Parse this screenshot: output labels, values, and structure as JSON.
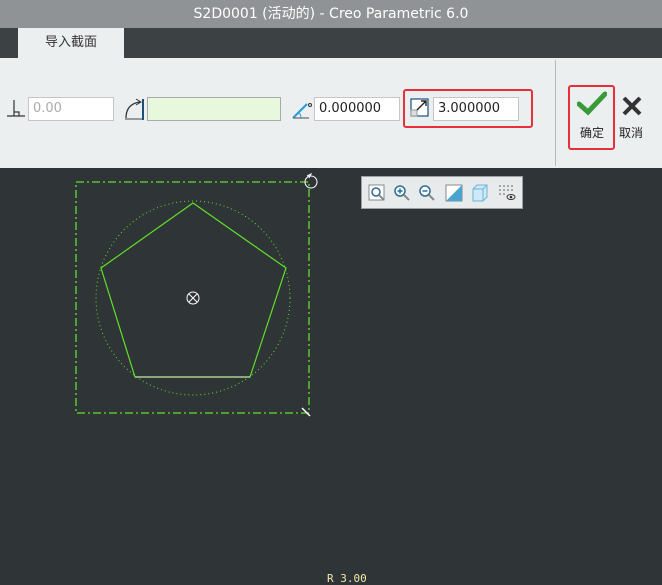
{
  "window": {
    "title": "S2D0001 (活动的) - Creo Parametric 6.0"
  },
  "tabs": [
    {
      "label": "导入截面"
    }
  ],
  "ribbon": {
    "offset_value": "0.00",
    "reference_value": "",
    "rotation_value": "0.000000",
    "scale_value": "3.000000",
    "ok_label": "确定",
    "cancel_label": "取消"
  },
  "canvas": {
    "dimension_label": "R 3.00"
  },
  "colors": {
    "sketch": "#5ee02a",
    "highlight": "#e8303a",
    "canvas_bg": "#2f3436"
  }
}
